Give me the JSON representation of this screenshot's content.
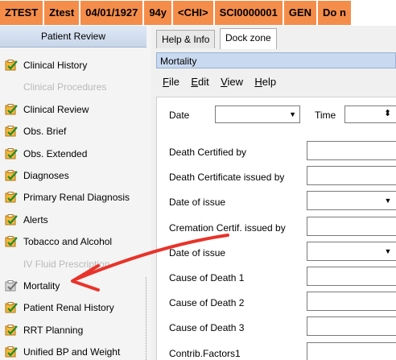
{
  "banner": [
    "ZTEST",
    "Ztest",
    "04/01/1927",
    "94y",
    "<CHI>",
    "SCI0000001",
    "GEN",
    "Do n"
  ],
  "sidebar": {
    "header": "Patient Review",
    "items": [
      {
        "label": "Clinical History",
        "enabled": true
      },
      {
        "label": "Clinical Procedures",
        "enabled": false
      },
      {
        "label": "Clinical Review",
        "enabled": true
      },
      {
        "label": "Obs. Brief",
        "enabled": true
      },
      {
        "label": "Obs. Extended",
        "enabled": true
      },
      {
        "label": "Diagnoses",
        "enabled": true
      },
      {
        "label": "Primary Renal Diagnosis",
        "enabled": true
      },
      {
        "label": "Alerts",
        "enabled": true
      },
      {
        "label": "Tobacco and Alcohol",
        "enabled": true
      },
      {
        "label": "IV Fluid Prescription",
        "enabled": false
      },
      {
        "label": "Mortality",
        "enabled": true
      },
      {
        "label": "Patient Renal History",
        "enabled": true
      },
      {
        "label": "RRT Planning",
        "enabled": true
      },
      {
        "label": "Unified BP and Weight",
        "enabled": true
      }
    ]
  },
  "tabs": [
    "Help & Info",
    "Dock zone"
  ],
  "panel": {
    "title": "Mortality",
    "menu": [
      {
        "key": "F",
        "rest": "ile"
      },
      {
        "key": "E",
        "rest": "dit"
      },
      {
        "key": "V",
        "rest": "iew"
      },
      {
        "key": "H",
        "rest": "elp"
      }
    ]
  },
  "form": {
    "date_label": "Date",
    "time_label": "Time",
    "fields": [
      "Death Certified by",
      "Death Certificate issued by",
      "Date of issue",
      "Cremation Certif. issued by",
      "Date of issue",
      "Cause of Death 1",
      "Cause of Death 2",
      "Cause of Death 3",
      "Contrib.Factors1"
    ]
  },
  "colors": {
    "banner": "#f58d4a",
    "annotation_arrow": "#e8332a",
    "panel_title": "#c9d9ef"
  }
}
